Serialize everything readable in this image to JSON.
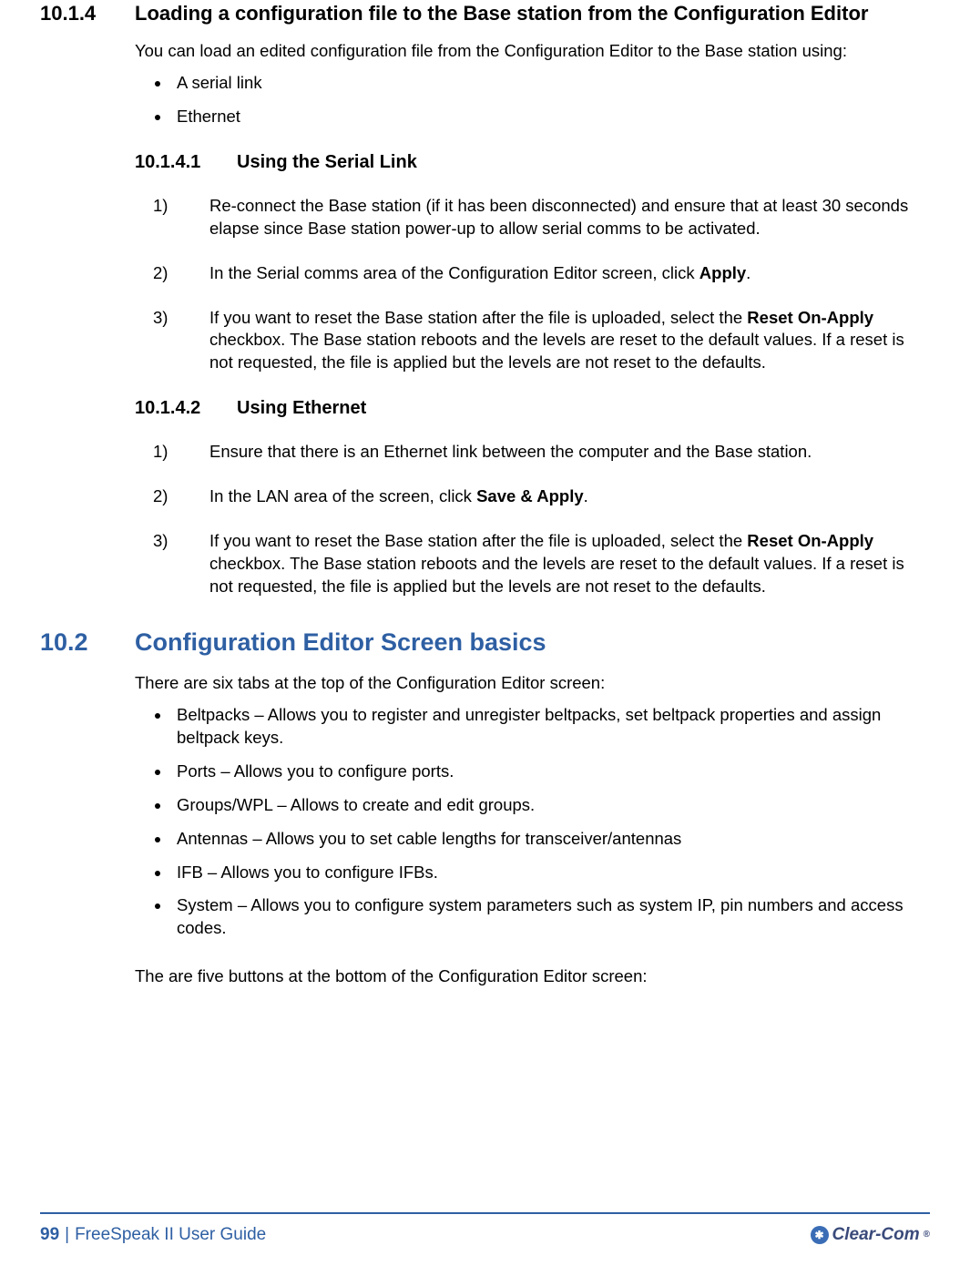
{
  "section_10_1_4": {
    "number": "10.1.4",
    "title": "Loading a configuration file to the Base station from the Configuration Editor",
    "intro": "You can load an edited configuration file from the Configuration Editor to the Base station using:",
    "bullets": [
      "A serial link",
      "Ethernet"
    ],
    "sub_1": {
      "number": "10.1.4.1",
      "title": "Using the Serial Link",
      "steps": [
        {
          "n": "1)",
          "text": "Re-connect the Base station (if it has been disconnected) and ensure that at least 30 seconds elapse since Base station power-up to allow serial comms to be activated."
        },
        {
          "n": "2)",
          "pre": "In the Serial comms area of the Configuration Editor screen, click ",
          "bold": "Apply",
          "post": "."
        },
        {
          "n": "3)",
          "pre": "If you want to reset the Base station after the file is uploaded, select the ",
          "bold": "Reset On-Apply",
          "post": " checkbox. The Base station reboots and the levels are reset to the default values. If a reset is not requested, the file is applied but the levels are not reset to the defaults."
        }
      ]
    },
    "sub_2": {
      "number": "10.1.4.2",
      "title": "Using Ethernet",
      "steps": [
        {
          "n": "1)",
          "text": "Ensure that there is an Ethernet link between the computer and the Base station."
        },
        {
          "n": "2)",
          "pre": "In the LAN area of the screen, click ",
          "bold": "Save & Apply",
          "post": "."
        },
        {
          "n": "3)",
          "pre": "If you want to reset the Base station after the file is uploaded, select the ",
          "bold": "Reset On-Apply",
          "post": " checkbox. The Base station reboots and the levels are reset to the default values. If a reset is not requested, the file is applied but the levels are not reset to the defaults."
        }
      ]
    }
  },
  "section_10_2": {
    "number": "10.2",
    "title": "Configuration Editor Screen basics",
    "intro": "There are six tabs at the top of the Configuration Editor screen:",
    "bullets": [
      "Beltpacks – Allows you to register and unregister beltpacks, set beltpack properties and assign beltpack keys.",
      "Ports – Allows you to configure ports.",
      "Groups/WPL – Allows to create and edit groups.",
      "Antennas – Allows you to set cable lengths for transceiver/antennas",
      "IFB – Allows you to configure IFBs.",
      "System – Allows you to configure system parameters such as system IP, pin numbers and access codes."
    ],
    "closing": "The are five buttons at the bottom of the Configuration Editor screen:"
  },
  "footer": {
    "page": "99",
    "doc": "FreeSpeak II User Guide",
    "brand": "Clear-Com"
  }
}
